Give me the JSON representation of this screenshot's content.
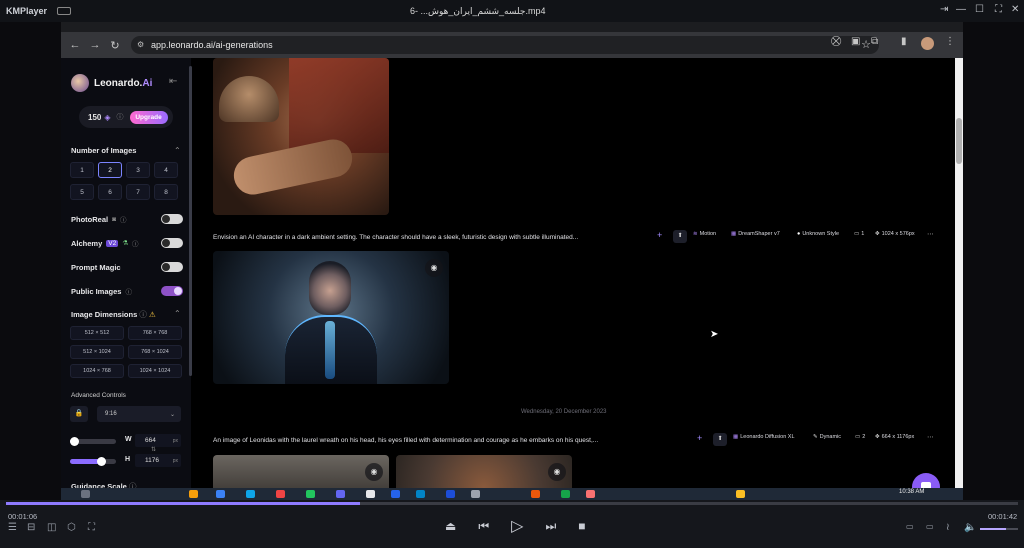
{
  "player": {
    "app_name": "KMPlayer",
    "file_title": "جلسه_ششم_ایران_هوش... -6.mp4",
    "time_current": "00:01:06",
    "time_total": "00:01:42",
    "progress": 0.35
  },
  "browser": {
    "url": "app.leonardo.ai/ai-generations"
  },
  "sidebar": {
    "brand_prefix": "Leonardo.",
    "brand_suffix": "Ai",
    "tokens": "150",
    "upgrade_label": "Upgrade",
    "number_of_images_label": "Number of Images",
    "number_options": [
      "1",
      "2",
      "3",
      "4",
      "5",
      "6",
      "7",
      "8"
    ],
    "number_selected": "2",
    "photoreal_label": "PhotoReal",
    "alchemy_label": "Alchemy",
    "alchemy_badge": "V2",
    "prompt_magic_label": "Prompt Magic",
    "public_images_label": "Public Images",
    "image_dimensions_label": "Image Dimensions",
    "dimensions": [
      "512 × 512",
      "768 × 768",
      "512 × 1024",
      "768 × 1024",
      "1024 × 768",
      "1024 × 1024"
    ],
    "advanced_controls_label": "Advanced Controls",
    "aspect_ratio": "9:16",
    "width_label": "W",
    "width_value": "664",
    "height_label": "H",
    "height_value": "1176",
    "unit": "px",
    "guidance_scale_label": "Guidance Scale"
  },
  "generations": [
    {
      "prompt": "Envision an AI character in a dark ambient setting. The character should have a sleek, futuristic design with subtle illuminated...",
      "motion_label": "Motion",
      "model": "DreamShaper v7",
      "style": "Unknown Style",
      "count": "1",
      "size": "1024 x 576px"
    },
    {
      "date": "Wednesday, 20 December 2023",
      "prompt": "An image of Leonidas with the laurel wreath on his head, his eyes filled with determination and courage as he embarks on his quest,...",
      "model": "Leonardo Diffusion XL",
      "style": "Dynamic",
      "count": "2",
      "size": "664 x 1176px"
    }
  ],
  "taskbar": {
    "clock_time": "10:38 AM"
  },
  "colors": {
    "accent": "#8b6cff",
    "upgrade_start": "#ff6ad0",
    "upgrade_end": "#9a6bff",
    "toggle_on": "#8e52c7"
  }
}
